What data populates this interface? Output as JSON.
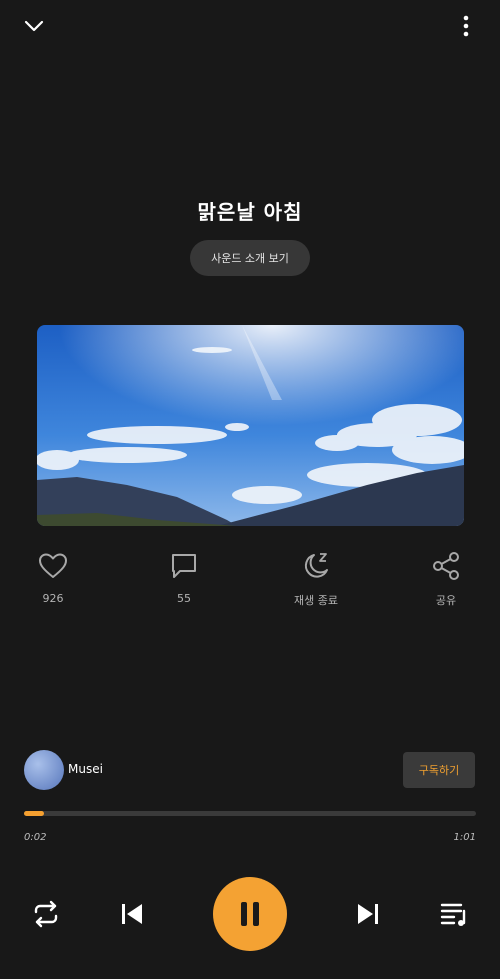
{
  "track": {
    "title": "맑은날 아침",
    "intro_button": "사운드 소개 보기"
  },
  "actions": [
    {
      "icon": "heart-icon",
      "label": "926"
    },
    {
      "icon": "comment-icon",
      "label": "55"
    },
    {
      "icon": "sleep-timer-icon",
      "label": "재생 종료"
    },
    {
      "icon": "share-icon",
      "label": "공유"
    }
  ],
  "channel": {
    "name": "Musei",
    "subscribe_label": "구독하기"
  },
  "player": {
    "current_time": "0:02",
    "total_time": "1:01",
    "progress_fraction": 0.045
  },
  "colors": {
    "accent": "#f4a233",
    "background": "#181818"
  }
}
